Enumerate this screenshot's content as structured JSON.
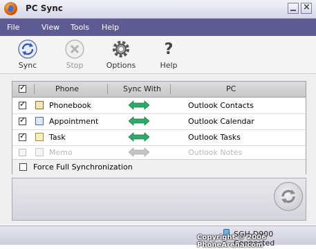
{
  "window": {
    "title": "PC Sync"
  },
  "menu": {
    "items": [
      {
        "label": "File"
      },
      {
        "label": "View"
      },
      {
        "label": "Tools"
      },
      {
        "label": "Help"
      }
    ]
  },
  "toolbar": {
    "sync": {
      "label": "Sync",
      "icon": "sync-icon"
    },
    "stop": {
      "label": "Stop",
      "icon": "stop-icon",
      "disabled": true
    },
    "options": {
      "label": "Options",
      "icon": "gear-icon"
    },
    "help": {
      "label": "Help",
      "icon": "help-icon"
    }
  },
  "table": {
    "headers": {
      "phone": "Phone",
      "sync_with": "Sync With",
      "pc": "PC"
    },
    "rows": [
      {
        "name": "Phonebook",
        "pc": "Outlook Contacts",
        "checked": true,
        "enabled": true
      },
      {
        "name": "Appointment",
        "pc": "Outlook Calendar",
        "checked": true,
        "enabled": true
      },
      {
        "name": "Task",
        "pc": "Outlook Tasks",
        "checked": true,
        "enabled": true
      },
      {
        "name": "Memo",
        "pc": "Outlook Notes",
        "checked": false,
        "enabled": false
      }
    ],
    "force_sync": {
      "label": "Force Full Synchronization",
      "checked": false
    }
  },
  "status": {
    "connection": "SGH-D900 Connected"
  },
  "watermark": "Copyright © 2006 PhoneArena.com",
  "colors": {
    "menubar": "#5e5a94",
    "arrow": "#2eaa6a",
    "arrow_disabled": "#c4c4c4"
  }
}
